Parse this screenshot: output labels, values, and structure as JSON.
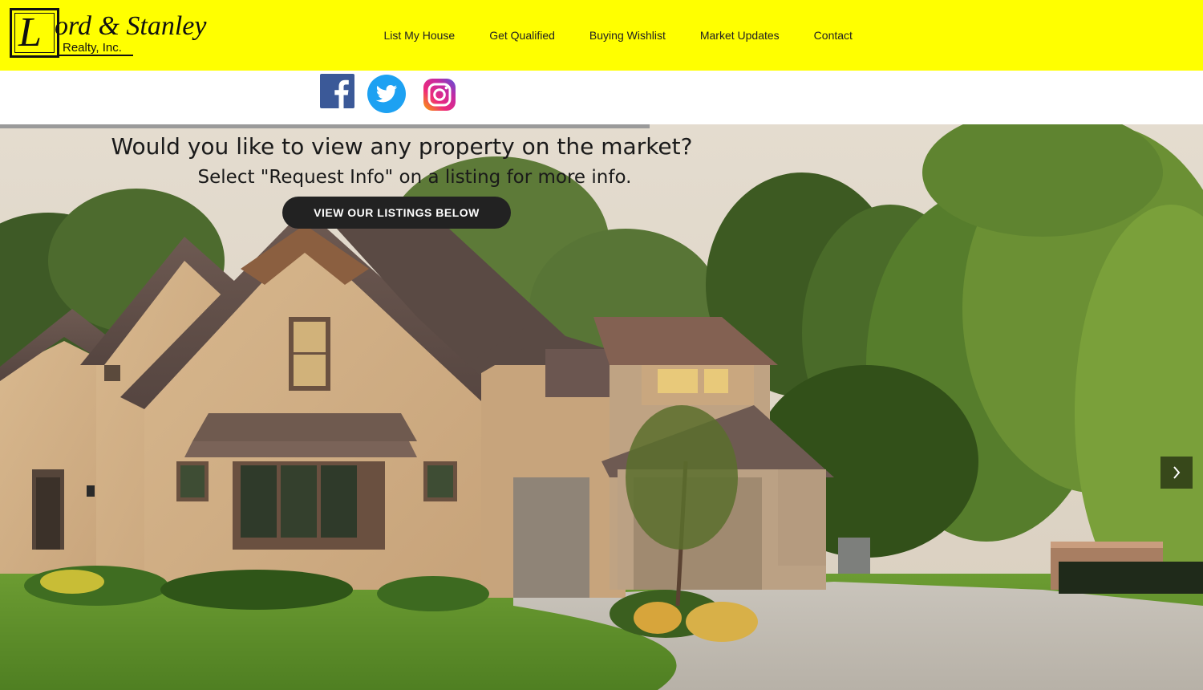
{
  "brand": {
    "logo_letter": "L",
    "name": "ord & Stanley",
    "sub": "Realty, Inc."
  },
  "nav": {
    "items": [
      {
        "label": "List My House"
      },
      {
        "label": "Get Qualified"
      },
      {
        "label": "Buying Wishlist"
      },
      {
        "label": "Market Updates"
      },
      {
        "label": "Contact"
      }
    ]
  },
  "social": {
    "icons": [
      "facebook-icon",
      "twitter-icon",
      "instagram-icon"
    ]
  },
  "hero": {
    "title": "Would you like to view any property on the market?",
    "subtitle": "Select \"Request Info\" on a listing for more info.",
    "button_label": "VIEW OUR LISTINGS BELOW",
    "slide_progress": 0.54,
    "next_icon": "chevron-right-icon"
  },
  "colors": {
    "header_bg": "#ffff00",
    "button_bg": "#222222",
    "facebook": "#3b5998",
    "twitter": "#1da1f2"
  }
}
